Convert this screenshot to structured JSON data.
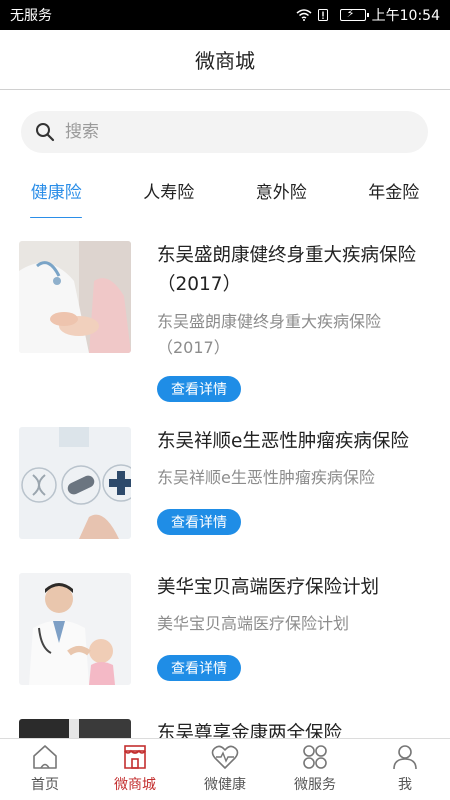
{
  "status_bar": {
    "carrier": "无服务",
    "time": "上午10:54"
  },
  "header": {
    "title": "微商城"
  },
  "search": {
    "placeholder": "搜索"
  },
  "category_tabs": [
    {
      "label": "健康险",
      "active": true
    },
    {
      "label": "人寿险",
      "active": false
    },
    {
      "label": "意外险",
      "active": false
    },
    {
      "label": "年金险",
      "active": false
    }
  ],
  "products": [
    {
      "title": "东吴盛朗康健终身重大疾病保险（2017）",
      "desc": "东吴盛朗康健终身重大疾病保险（2017）",
      "button": "查看详情",
      "image_icon": "doctor-patient-photo"
    },
    {
      "title": "东吴祥顺e生恶性肿瘤疾病保险",
      "desc": "东吴祥顺e生恶性肿瘤疾病保险",
      "button": "查看详情",
      "image_icon": "medical-icons-photo"
    },
    {
      "title": "美华宝贝高端医疗保险计划",
      "desc": "美华宝贝高端医疗保险计划",
      "button": "查看详情",
      "image_icon": "doctor-child-photo"
    },
    {
      "title": "东吴尊享金康两全保险",
      "desc": "",
      "button": "",
      "image_icon": "business-photo"
    }
  ],
  "bottom_tabs": [
    {
      "label": "首页",
      "icon": "home-icon",
      "active": false
    },
    {
      "label": "微商城",
      "icon": "shop-icon",
      "active": true
    },
    {
      "label": "微健康",
      "icon": "heart-pulse-icon",
      "active": false
    },
    {
      "label": "微服务",
      "icon": "grid-icon",
      "active": false
    },
    {
      "label": "我",
      "icon": "person-icon",
      "active": false
    }
  ],
  "colors": {
    "accent": "#2b8ee8",
    "button": "#1f8de6",
    "active_tab": "#c32f2f"
  }
}
